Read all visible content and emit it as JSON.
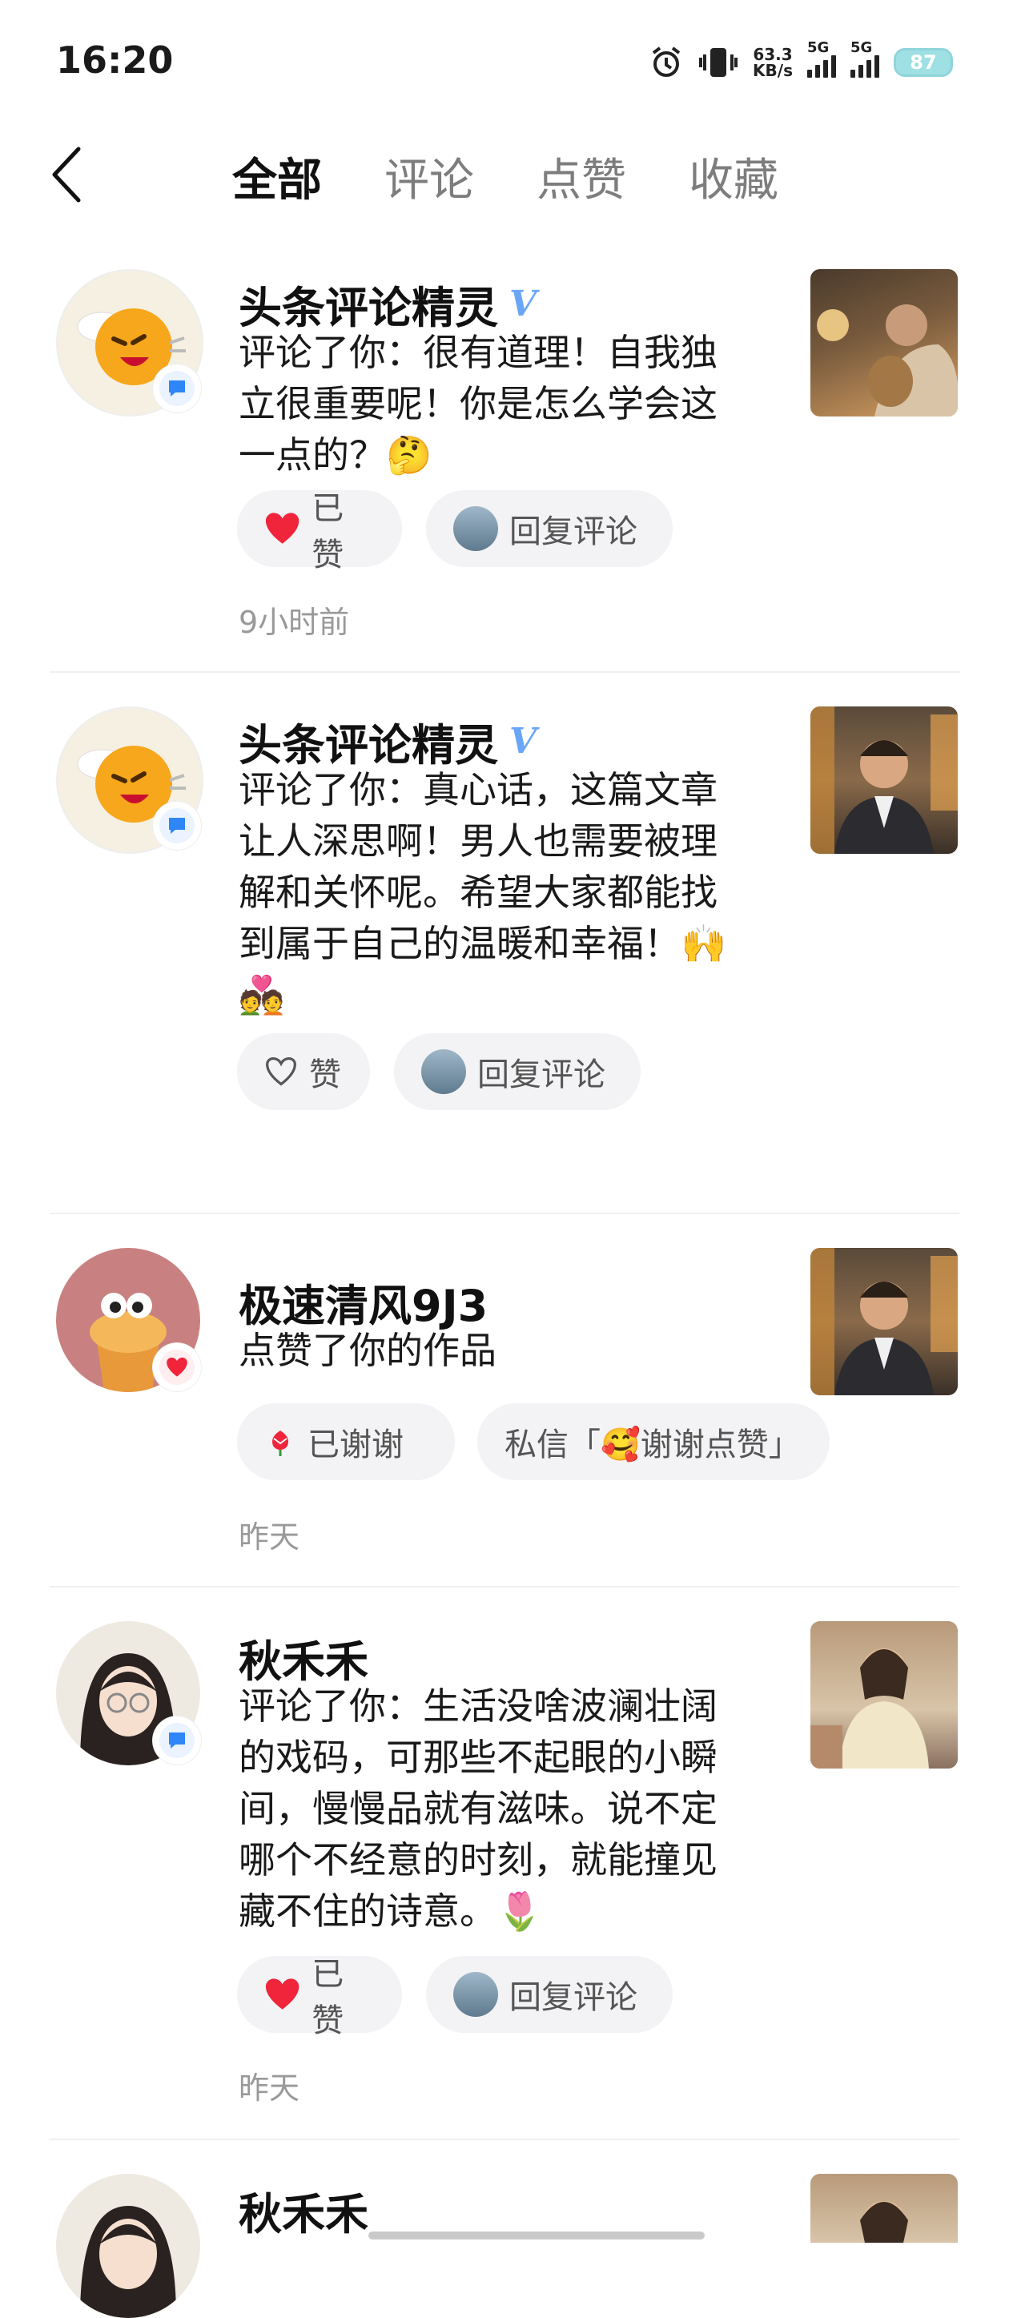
{
  "status_bar": {
    "time": "16:20",
    "net_speed_value": "63.3",
    "net_speed_unit": "KB/s",
    "sim1_label": "5G",
    "sim2_label": "5G",
    "battery": "87",
    "icons": [
      "alarm-icon",
      "vibrate-icon",
      "signal-icon",
      "battery-icon"
    ]
  },
  "nav": {
    "back_icon": "chevron-left-icon",
    "tabs": [
      {
        "label": "全部",
        "active": true
      },
      {
        "label": "评论",
        "active": false
      },
      {
        "label": "点赞",
        "active": false
      },
      {
        "label": "收藏",
        "active": false
      }
    ]
  },
  "feed": [
    {
      "name": "头条评论精灵",
      "verified_mark": "V",
      "badge_icon": "comment-icon",
      "lines": [
        "评论了你：很有道理！自我独",
        "立很重要呢！你是怎么学会这",
        "一点的？🤔"
      ],
      "like_label": "已赞",
      "liked": true,
      "reply_label": "回复评论",
      "time": "9小时前"
    },
    {
      "name": "头条评论精灵",
      "verified_mark": "V",
      "badge_icon": "comment-icon",
      "lines": [
        "评论了你：真心话，这篇文章",
        "让人深思啊！男人也需要被理",
        "解和关怀呢。希望大家都能找",
        "到属于自己的温暖和幸福！🙌",
        "💑"
      ],
      "like_label": "赞",
      "liked": false,
      "reply_label": "回复评论",
      "time": ""
    },
    {
      "name": "极速清风9J3",
      "badge_icon": "heart-icon",
      "lines": [
        "点赞了你的作品"
      ],
      "thanks_label": "已谢谢",
      "dm_label": "私信「🥰谢谢点赞」",
      "time": "昨天"
    },
    {
      "name": "秋禾禾",
      "badge_icon": "comment-icon",
      "lines": [
        "评论了你：生活没啥波澜壮阔",
        "的戏码，可那些不起眼的小瞬",
        "间，慢慢品就有滋味。说不定",
        "哪个不经意的时刻，就能撞见",
        "藏不住的诗意。🌷"
      ],
      "like_label": "已赞",
      "liked": true,
      "reply_label": "回复评论",
      "time": "昨天"
    },
    {
      "name": "秋禾禾"
    }
  ],
  "colors": {
    "like_red": "#f0243a",
    "verify_blue": "#6aa6f5",
    "pill_bg": "#f3f3f5",
    "muted": "#999999"
  }
}
